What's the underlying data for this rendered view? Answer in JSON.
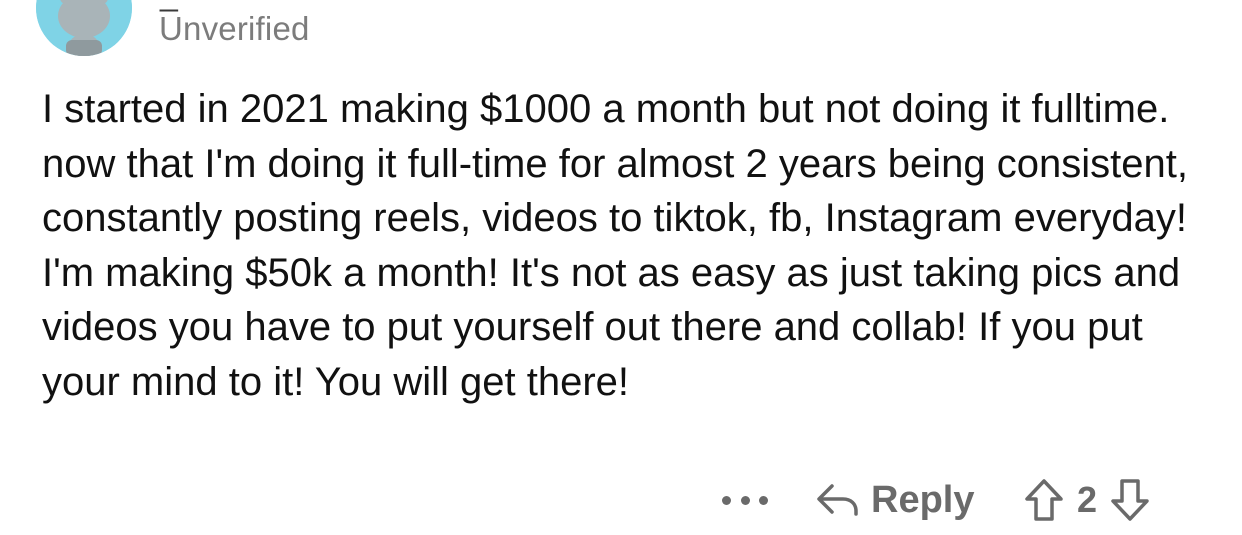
{
  "comment": {
    "author_visible": "_",
    "flair": "Unverified",
    "body": "I started in 2021 making $1000 a month but not doing it fulltime. now that I'm doing it full-time for almost 2 years being consistent, constantly posting reels, videos to tiktok, fb, Instagram everyday!  I'm making $50k a month! It's not as easy as just taking pics and videos you have to put yourself out there and collab! If you put your mind to it! You will get there!",
    "actions": {
      "reply_label": "Reply",
      "vote_count": "2"
    }
  },
  "icons": {
    "avatar": "snoo-avatar-icon",
    "more": "more-horizontal-icon",
    "reply": "reply-arrow-icon",
    "upvote": "upvote-arrow-icon",
    "downvote": "downvote-arrow-icon"
  },
  "colors": {
    "avatar_bg": "#7fd3e6",
    "muted_text": "#6a6a6a",
    "body_text": "#111111"
  }
}
